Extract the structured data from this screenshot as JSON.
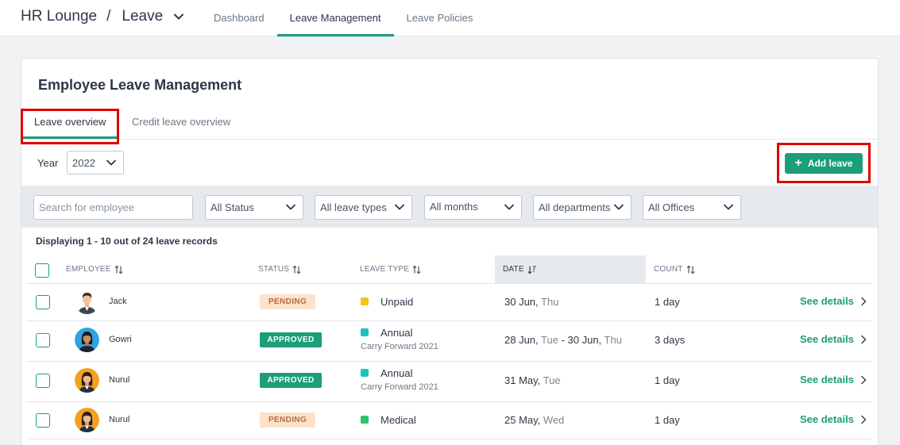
{
  "header": {
    "app_name": "HR Lounge",
    "separator": "/",
    "module": "Leave",
    "tabs": [
      {
        "label": "Dashboard",
        "active": false
      },
      {
        "label": "Leave Management",
        "active": true
      },
      {
        "label": "Leave Policies",
        "active": false
      }
    ]
  },
  "card": {
    "title": "Employee Leave Management",
    "subtabs": [
      {
        "label": "Leave overview",
        "active": true
      },
      {
        "label": "Credit leave overview",
        "active": false
      }
    ],
    "year_label": "Year",
    "year_value": "2022",
    "add_leave_label": "Add leave"
  },
  "filters": {
    "search_placeholder": "Search for employee",
    "status": "All Status",
    "leave_types": "All leave types",
    "months": "All months",
    "departments": "All departments",
    "offices": "All Offices"
  },
  "display_count": "Displaying 1 - 10 out of 24 leave records",
  "table": {
    "headers": {
      "employee": "EMPLOYEE",
      "status": "STATUS",
      "leave_type": "LEAVE TYPE",
      "date": "DATE",
      "count": "COUNT"
    },
    "rows": [
      {
        "name": "Jack",
        "status": "PENDING",
        "status_kind": "pending",
        "leave_type": "Unpaid",
        "leave_sub": "",
        "dot_color": "#f5c518",
        "date_a": "30 Jun,",
        "day_a": " Thu",
        "date_sep": "",
        "date_b": "",
        "day_b": "",
        "count": "1 day",
        "details": "See details"
      },
      {
        "name": "Gowri",
        "status": "APPROVED",
        "status_kind": "approved",
        "leave_type": "Annual",
        "leave_sub": "Carry Forward 2021",
        "dot_color": "#1cc2c2",
        "date_a": "28 Jun,",
        "day_a": " Tue",
        "date_sep": " - ",
        "date_b": "30 Jun,",
        "day_b": " Thu",
        "count": "3 days",
        "details": "See details"
      },
      {
        "name": "Nurul",
        "status": "APPROVED",
        "status_kind": "approved",
        "leave_type": "Annual",
        "leave_sub": "Carry Forward 2021",
        "dot_color": "#1cc2c2",
        "date_a": "31 May,",
        "day_a": " Tue",
        "date_sep": "",
        "date_b": "",
        "day_b": "",
        "count": "1 day",
        "details": "See details"
      },
      {
        "name": "Nurul",
        "status": "PENDING",
        "status_kind": "pending",
        "leave_type": "Medical",
        "leave_sub": "",
        "dot_color": "#2ec46b",
        "date_a": "25 May,",
        "day_a": " Wed",
        "date_sep": "",
        "date_b": "",
        "day_b": "",
        "count": "1 day",
        "details": "See details"
      }
    ]
  },
  "colors": {
    "accent": "#1b9e7a",
    "highlight": "#e00000",
    "pending_bg": "#fde2cc",
    "pending_text": "#b86b3a"
  }
}
